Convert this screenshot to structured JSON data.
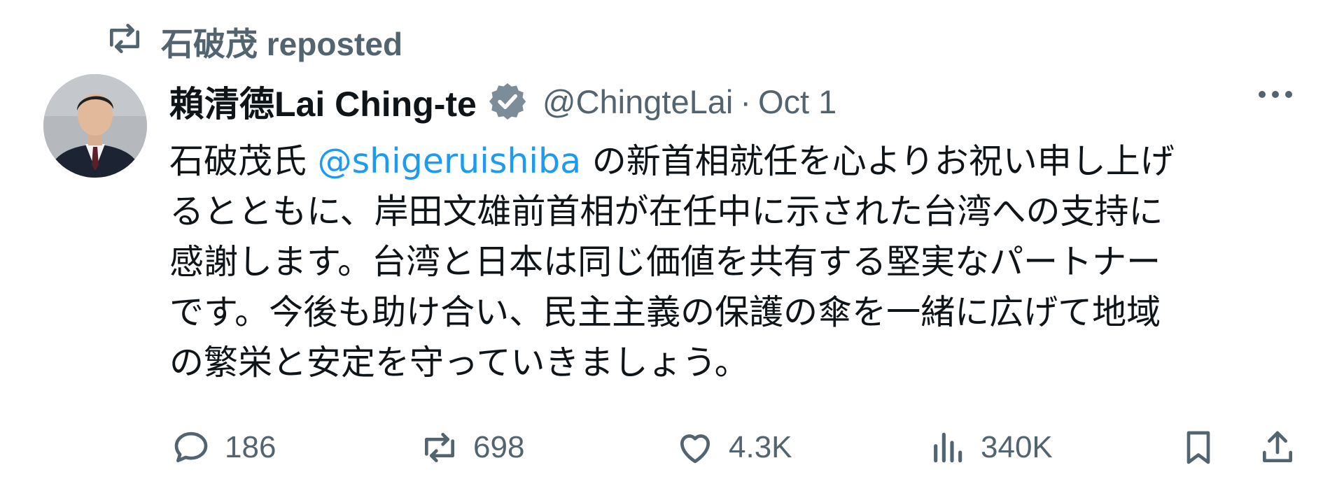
{
  "repost": {
    "icon": "repost-icon",
    "text": "石破茂 reposted"
  },
  "author": {
    "display_name": "賴清德Lai Ching-te",
    "verified": true,
    "handle": "@ChingteLai",
    "separator": "·",
    "date": "Oct 1"
  },
  "body": {
    "lines": [
      {
        "pre": "石破茂氏 ",
        "mention": "@shigeruishiba",
        "post": " の新首相就任を心よりお祝い申し上げ"
      },
      {
        "text": "るとともに、岸田文雄前首相が在任中に示された台湾への支持に"
      },
      {
        "text": "感謝します。台湾と日本は同じ価値を共有する堅実なパートナー"
      },
      {
        "text": "です。今後も助け合い、民主主義の保護の傘を一緒に広げて地域"
      },
      {
        "text": "の繁栄と安定を守っていきましょう。"
      }
    ]
  },
  "actions": {
    "reply": {
      "icon": "reply-icon",
      "count": "186"
    },
    "repost": {
      "icon": "repost-icon",
      "count": "698"
    },
    "like": {
      "icon": "heart-icon",
      "count": "4.3K"
    },
    "views": {
      "icon": "views-icon",
      "count": "340K"
    },
    "bookmark": {
      "icon": "bookmark-icon"
    },
    "share": {
      "icon": "share-icon"
    }
  },
  "colors": {
    "text": "#0f1419",
    "secondary": "#536471",
    "accent": "#1d9bf0"
  }
}
